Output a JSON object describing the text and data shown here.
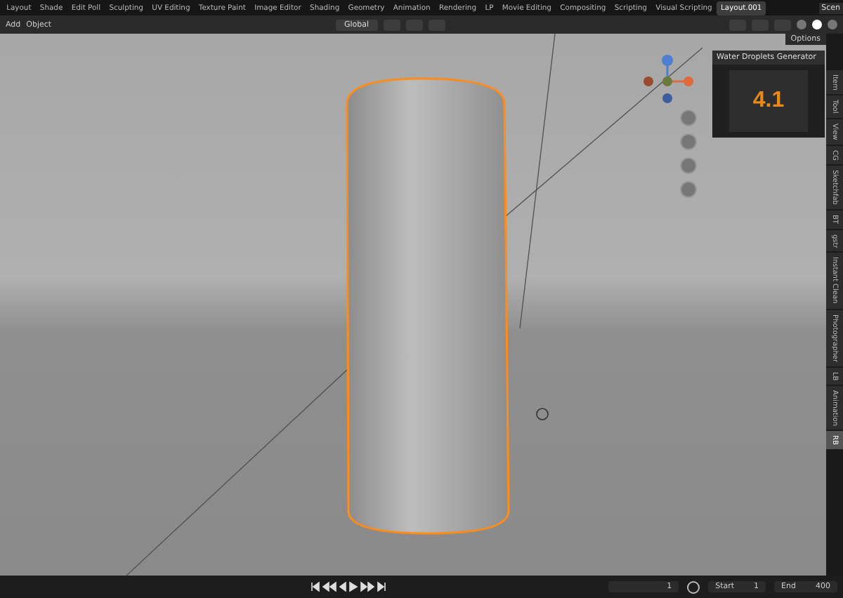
{
  "workspace_tabs": [
    {
      "label": "Layout",
      "selected": false
    },
    {
      "label": "Shade",
      "selected": false
    },
    {
      "label": "Edit Poll",
      "selected": false
    },
    {
      "label": "Sculpting",
      "selected": false
    },
    {
      "label": "UV Editing",
      "selected": false
    },
    {
      "label": "Texture Paint",
      "selected": false
    },
    {
      "label": "Image Editor",
      "selected": false
    },
    {
      "label": "Shading",
      "selected": false
    },
    {
      "label": "Geometry",
      "selected": false
    },
    {
      "label": "Animation",
      "selected": false
    },
    {
      "label": "Rendering",
      "selected": false
    },
    {
      "label": "LP",
      "selected": false
    },
    {
      "label": "Movie Editing",
      "selected": false
    },
    {
      "label": "Compositing",
      "selected": false
    },
    {
      "label": "Scripting",
      "selected": false
    },
    {
      "label": "Visual Scripting",
      "selected": false
    },
    {
      "label": "Layout.001",
      "selected": true
    }
  ],
  "scene_field": "Scen",
  "header": {
    "menus": [
      "Add",
      "Object"
    ],
    "orientation": "Global"
  },
  "viewport": {
    "options_button": "Options"
  },
  "addon_panel": {
    "title": "Water Droplets Generator",
    "thumbnail_text": "4.1"
  },
  "side_tabs": [
    {
      "label": "Item",
      "selected": false
    },
    {
      "label": "Tool",
      "selected": false
    },
    {
      "label": "View",
      "selected": false
    },
    {
      "label": "CG",
      "selected": false
    },
    {
      "label": "Sketchfab",
      "selected": false
    },
    {
      "label": "BT",
      "selected": false
    },
    {
      "label": "gstr",
      "selected": false
    },
    {
      "label": "Instant Clean",
      "selected": false
    },
    {
      "label": "Photographer",
      "selected": false
    },
    {
      "label": "LB",
      "selected": false
    },
    {
      "label": "Animation",
      "selected": false
    },
    {
      "label": "RB",
      "selected": true
    }
  ],
  "timeline": {
    "current_frame": "1",
    "start_label": "Start",
    "start": "1",
    "end_label": "End",
    "end": "400"
  }
}
